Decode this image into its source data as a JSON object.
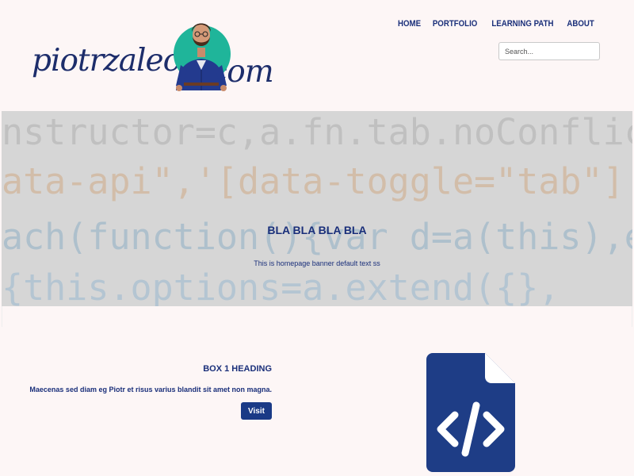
{
  "header": {
    "logo": {
      "name_text": "piotrzalecki",
      "suffix_text": ".com"
    },
    "nav": [
      {
        "label": "HOME"
      },
      {
        "label": "PORTFOLIO"
      },
      {
        "label": "LEARNING PATH"
      },
      {
        "label": "ABOUT"
      }
    ],
    "search": {
      "placeholder": "Search..."
    }
  },
  "banner": {
    "code_lines": [
      "nstructor=c,a.fn.tab.noConflict=",
      "ata-api\",'[data-toggle=\"tab\"]',e",
      "ach(function(){var d=a(this),e=d",
      "{this.options=a.extend({},"
    ],
    "title": "BLA BLA BLA BLA",
    "subtitle": "This is homepage banner default text ss"
  },
  "box1": {
    "heading": "BOX 1 HEADING",
    "text": "Maecenas sed diam eg Piotr et risus varius blandit sit amet non magna.",
    "button_label": "Visit",
    "icon": "file-code-icon"
  },
  "colors": {
    "brand": "#1a2f7a",
    "button": "#1a3a86",
    "icon": "#1e3d86",
    "background": "#fdf6f6"
  }
}
